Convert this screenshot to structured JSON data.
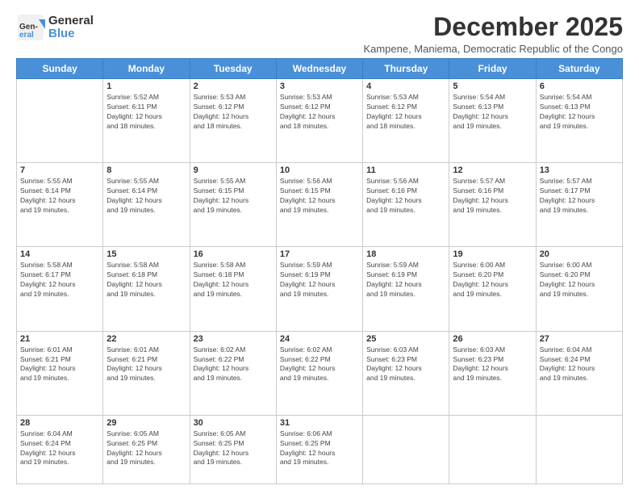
{
  "header": {
    "logo_general": "General",
    "logo_blue": "Blue",
    "month_title": "December 2025",
    "subtitle": "Kampene, Maniema, Democratic Republic of the Congo"
  },
  "weekdays": [
    "Sunday",
    "Monday",
    "Tuesday",
    "Wednesday",
    "Thursday",
    "Friday",
    "Saturday"
  ],
  "weeks": [
    [
      {
        "day": "",
        "info": ""
      },
      {
        "day": "1",
        "info": "Sunrise: 5:52 AM\nSunset: 6:11 PM\nDaylight: 12 hours\nand 18 minutes."
      },
      {
        "day": "2",
        "info": "Sunrise: 5:53 AM\nSunset: 6:12 PM\nDaylight: 12 hours\nand 18 minutes."
      },
      {
        "day": "3",
        "info": "Sunrise: 5:53 AM\nSunset: 6:12 PM\nDaylight: 12 hours\nand 18 minutes."
      },
      {
        "day": "4",
        "info": "Sunrise: 5:53 AM\nSunset: 6:12 PM\nDaylight: 12 hours\nand 18 minutes."
      },
      {
        "day": "5",
        "info": "Sunrise: 5:54 AM\nSunset: 6:13 PM\nDaylight: 12 hours\nand 19 minutes."
      },
      {
        "day": "6",
        "info": "Sunrise: 5:54 AM\nSunset: 6:13 PM\nDaylight: 12 hours\nand 19 minutes."
      }
    ],
    [
      {
        "day": "7",
        "info": "Sunrise: 5:55 AM\nSunset: 6:14 PM\nDaylight: 12 hours\nand 19 minutes."
      },
      {
        "day": "8",
        "info": "Sunrise: 5:55 AM\nSunset: 6:14 PM\nDaylight: 12 hours\nand 19 minutes."
      },
      {
        "day": "9",
        "info": "Sunrise: 5:55 AM\nSunset: 6:15 PM\nDaylight: 12 hours\nand 19 minutes."
      },
      {
        "day": "10",
        "info": "Sunrise: 5:56 AM\nSunset: 6:15 PM\nDaylight: 12 hours\nand 19 minutes."
      },
      {
        "day": "11",
        "info": "Sunrise: 5:56 AM\nSunset: 6:16 PM\nDaylight: 12 hours\nand 19 minutes."
      },
      {
        "day": "12",
        "info": "Sunrise: 5:57 AM\nSunset: 6:16 PM\nDaylight: 12 hours\nand 19 minutes."
      },
      {
        "day": "13",
        "info": "Sunrise: 5:57 AM\nSunset: 6:17 PM\nDaylight: 12 hours\nand 19 minutes."
      }
    ],
    [
      {
        "day": "14",
        "info": "Sunrise: 5:58 AM\nSunset: 6:17 PM\nDaylight: 12 hours\nand 19 minutes."
      },
      {
        "day": "15",
        "info": "Sunrise: 5:58 AM\nSunset: 6:18 PM\nDaylight: 12 hours\nand 19 minutes."
      },
      {
        "day": "16",
        "info": "Sunrise: 5:58 AM\nSunset: 6:18 PM\nDaylight: 12 hours\nand 19 minutes."
      },
      {
        "day": "17",
        "info": "Sunrise: 5:59 AM\nSunset: 6:19 PM\nDaylight: 12 hours\nand 19 minutes."
      },
      {
        "day": "18",
        "info": "Sunrise: 5:59 AM\nSunset: 6:19 PM\nDaylight: 12 hours\nand 19 minutes."
      },
      {
        "day": "19",
        "info": "Sunrise: 6:00 AM\nSunset: 6:20 PM\nDaylight: 12 hours\nand 19 minutes."
      },
      {
        "day": "20",
        "info": "Sunrise: 6:00 AM\nSunset: 6:20 PM\nDaylight: 12 hours\nand 19 minutes."
      }
    ],
    [
      {
        "day": "21",
        "info": "Sunrise: 6:01 AM\nSunset: 6:21 PM\nDaylight: 12 hours\nand 19 minutes."
      },
      {
        "day": "22",
        "info": "Sunrise: 6:01 AM\nSunset: 6:21 PM\nDaylight: 12 hours\nand 19 minutes."
      },
      {
        "day": "23",
        "info": "Sunrise: 6:02 AM\nSunset: 6:22 PM\nDaylight: 12 hours\nand 19 minutes."
      },
      {
        "day": "24",
        "info": "Sunrise: 6:02 AM\nSunset: 6:22 PM\nDaylight: 12 hours\nand 19 minutes."
      },
      {
        "day": "25",
        "info": "Sunrise: 6:03 AM\nSunset: 6:23 PM\nDaylight: 12 hours\nand 19 minutes."
      },
      {
        "day": "26",
        "info": "Sunrise: 6:03 AM\nSunset: 6:23 PM\nDaylight: 12 hours\nand 19 minutes."
      },
      {
        "day": "27",
        "info": "Sunrise: 6:04 AM\nSunset: 6:24 PM\nDaylight: 12 hours\nand 19 minutes."
      }
    ],
    [
      {
        "day": "28",
        "info": "Sunrise: 6:04 AM\nSunset: 6:24 PM\nDaylight: 12 hours\nand 19 minutes."
      },
      {
        "day": "29",
        "info": "Sunrise: 6:05 AM\nSunset: 6:25 PM\nDaylight: 12 hours\nand 19 minutes."
      },
      {
        "day": "30",
        "info": "Sunrise: 6:05 AM\nSunset: 6:25 PM\nDaylight: 12 hours\nand 19 minutes."
      },
      {
        "day": "31",
        "info": "Sunrise: 6:06 AM\nSunset: 6:25 PM\nDaylight: 12 hours\nand 19 minutes."
      },
      {
        "day": "",
        "info": ""
      },
      {
        "day": "",
        "info": ""
      },
      {
        "day": "",
        "info": ""
      }
    ]
  ]
}
